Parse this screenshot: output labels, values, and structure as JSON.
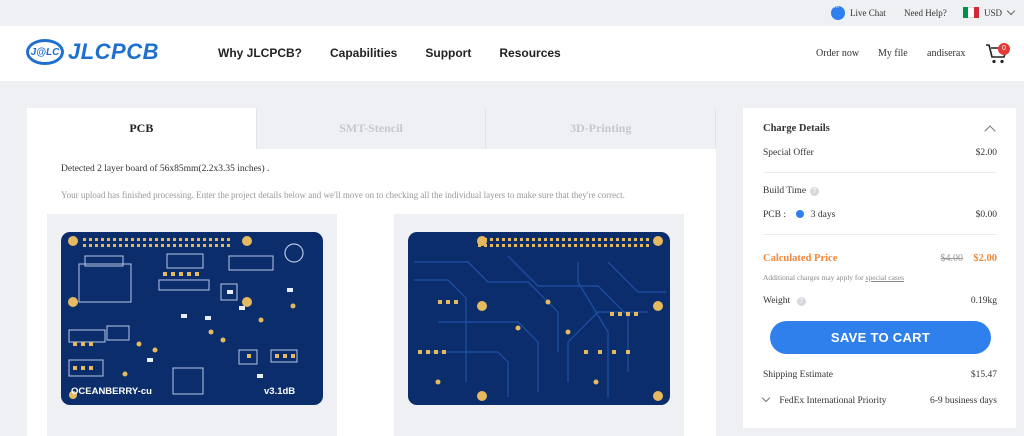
{
  "topbar": {
    "live_chat": "Live Chat",
    "need_help": "Need Help?",
    "currency": "USD",
    "flag_colors": [
      "#009246",
      "#ffffff",
      "#ce2b37"
    ]
  },
  "header": {
    "logo_mark": "J@LC",
    "logo_text": "JLCPCB",
    "nav": [
      "Why JLCPCB?",
      "Capabilities",
      "Support",
      "Resources"
    ],
    "order_now": "Order now",
    "my_file": "My file",
    "username": "andiserax",
    "cart_count": "0",
    "accent": "#1f6fd1"
  },
  "main": {
    "tabs": [
      "PCB",
      "SMT-Stencil",
      "3D-Printing"
    ],
    "active_tab": "PCB",
    "detected": "Detected 2 layer board of 56x85mm(2.2x3.35 inches) .",
    "upload_msg": "Your upload has finished processing. Enter the project details below and we'll move on to checking all the individual layers to make sure that they're correct.",
    "top_board": {
      "name_label": "OCEANBERRY-cu",
      "version_label": "v3.1dB",
      "board_color": "#0b2d6b",
      "pad_color": "#e5b960"
    },
    "bottom_board": {
      "board_color": "#0b2d6b"
    }
  },
  "charge": {
    "title": "Charge Details",
    "special_offer_label": "Special Offer",
    "special_offer_value": "$2.00",
    "build_time_label": "Build Time",
    "pcb_label": "PCB :",
    "pcb_time": "3 days",
    "pcb_value": "$0.00",
    "calc_label": "Calculated Price",
    "old_price": "$4.00",
    "new_price": "$2.00",
    "note_prefix": "Additional charges may apply for",
    "note_link": "special cases",
    "weight_label": "Weight",
    "weight_value": "0.19kg",
    "save_button": "SAVE TO CART",
    "shipping_label": "Shipping Estimate",
    "shipping_value": "$15.47",
    "carrier": "FedEx International Priority",
    "delivery": "6-9 business days",
    "accent": "#2f80ed",
    "price_color": "#f0873a"
  }
}
